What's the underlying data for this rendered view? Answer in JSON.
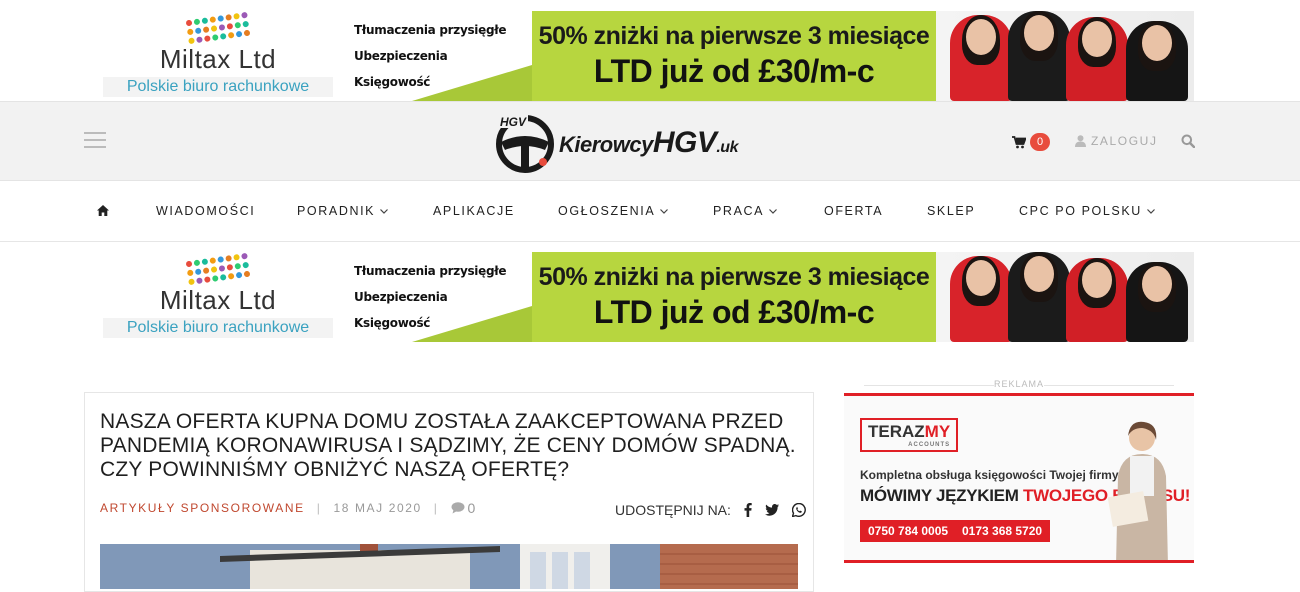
{
  "banner": {
    "brand": "Miltax Ltd",
    "sub": "Polskie biuro rachunkowe",
    "services": [
      "Tłumaczenia przysięgłe",
      "Ubezpieczenia",
      "Księgowość"
    ],
    "promo_line1": "50% zniżki na pierwsze 3 miesiące",
    "promo_line2": "LTD już od £30/m-c",
    "colors": {
      "green": "#b7d63f",
      "sub_text": "#3aa2c0"
    }
  },
  "header": {
    "logo_parts": {
      "k": "Kierowcy",
      "h": "HGV",
      "u": ".uk",
      "badge": "HGV"
    },
    "cart_count": "0",
    "login_label": "ZALOGUJ",
    "icons": [
      "menu-icon",
      "cart-icon",
      "user-icon",
      "search-icon"
    ]
  },
  "nav": {
    "items": [
      {
        "label": "",
        "icon": "home-icon"
      },
      {
        "label": "WIADOMOŚCI"
      },
      {
        "label": "PORADNIK",
        "dropdown": true
      },
      {
        "label": "APLIKACJE"
      },
      {
        "label": "OGŁOSZENIA",
        "dropdown": true
      },
      {
        "label": "PRACA",
        "dropdown": true
      },
      {
        "label": "OFERTA"
      },
      {
        "label": "SKLEP"
      },
      {
        "label": "CPC PO POLSKU",
        "dropdown": true
      }
    ]
  },
  "article": {
    "title": "NASZA OFERTA KUPNA DOMU ZOSTAŁA ZAAKCEPTOWANA PRZED PANDEMIĄ KORONAWIRUSA I SĄDZIMY, ŻE CENY DOMÓW SPADNĄ. CZY POWINNIŚMY OBNIŻYĆ NASZĄ OFERTĘ?",
    "category": "ARTYKUŁY SPONSOROWANE",
    "separator": "|",
    "date": "18 MAJ 2020",
    "comments": "0",
    "share_label": "UDOSTĘPNIJ NA:",
    "share_icons": [
      "facebook-icon",
      "twitter-icon",
      "whatsapp-icon"
    ],
    "accent_color": "#c0482f"
  },
  "sidebar": {
    "ad_label": "REKLAMA",
    "ad": {
      "logo_a": "TERAZ",
      "logo_b": "MY",
      "logo_small": "ACCOUNTS",
      "line1": "Kompletna obsługa księgowości Twojej firmy",
      "line2a": "MÓWIMY JĘZYKIEM ",
      "line2b": "TWOJEGO BIZNESU!",
      "phone1": "0750 784 0005",
      "phone2": "0173 368 5720",
      "accent_color": "#e01f26"
    }
  }
}
